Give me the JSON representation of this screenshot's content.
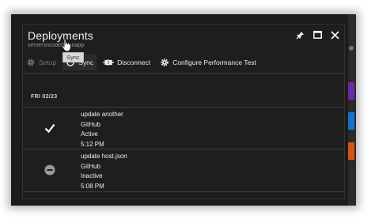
{
  "window": {
    "title": "Deployments",
    "subtitle": "serversncodedemoapp"
  },
  "window_controls": [
    "pin-icon",
    "maximize-icon",
    "close-icon"
  ],
  "toolbar": {
    "setup_label": "Setup",
    "sync_label": "Sync",
    "disconnect_label": "Disconnect",
    "configure_label": "Configure Performance Test"
  },
  "tooltip": {
    "text": "Sync"
  },
  "date_group": "FRI 02/23",
  "deployments": [
    {
      "message": "update another",
      "source": "GitHub",
      "status": "Active",
      "time": "5:12 PM",
      "status_icon": "checkmark-icon"
    },
    {
      "message": "update host.json",
      "source": "GitHub",
      "status": "Inactive",
      "time": "5:08 PM",
      "status_icon": "minus-circle-icon"
    }
  ],
  "colors": {
    "blade_bg": "#1e1e1e",
    "text": "#eeeeee",
    "muted": "#777777",
    "divider": "#3a3a3a"
  }
}
